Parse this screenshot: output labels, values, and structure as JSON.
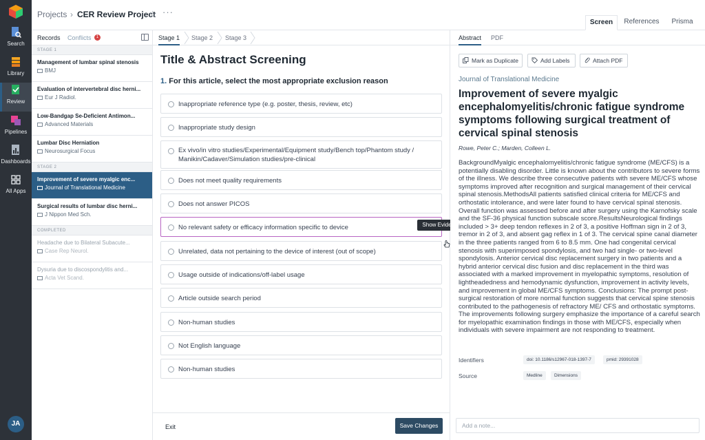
{
  "nav": {
    "items": [
      {
        "label": "Search",
        "icon": "search-doc-icon"
      },
      {
        "label": "Library",
        "icon": "library-icon"
      },
      {
        "label": "Review",
        "icon": "review-icon"
      },
      {
        "label": "Pipelines",
        "icon": "pipelines-icon"
      },
      {
        "label": "Dashboards",
        "icon": "dashboards-icon"
      },
      {
        "label": "All Apps",
        "icon": "grid-icon"
      }
    ],
    "avatar": "JA"
  },
  "header": {
    "breadcrumb": "Projects",
    "project": "CER Review Project",
    "tabs": [
      "Screen",
      "References",
      "Prisma"
    ],
    "active_tab": "Screen"
  },
  "records": {
    "tabs": {
      "records": "Records",
      "conflicts": "Conflicts",
      "conflict_count": "1"
    },
    "groups": [
      {
        "label": "STAGE 1",
        "items": [
          {
            "title": "Management of lumbar spinal stenosis",
            "source": "BMJ"
          },
          {
            "title": "Evaluation of intervertebral disc herni...",
            "source": "Eur J Radiol."
          },
          {
            "title": "Low-Bandgap Se-Deficient Antimon...",
            "source": "Advanced Materials"
          },
          {
            "title": "Lumbar Disc Herniation",
            "source": "Neurosurgical Focus"
          }
        ]
      },
      {
        "label": "STAGE 2",
        "items": [
          {
            "title": "Improvement of severe myalgic enc...",
            "source": "Journal of Translational Medicine"
          },
          {
            "title": "Surgical results of lumbar disc herni...",
            "source": "J Nippon Med Sch."
          }
        ]
      },
      {
        "label": "COMPLETED",
        "items": [
          {
            "title": "Headache due to Bilateral Subacute...",
            "source": "Case Rep Neurol."
          },
          {
            "title": "Dysuria due to discospondylitis and...",
            "source": "Acta Vet Scand."
          }
        ]
      }
    ]
  },
  "screening": {
    "stages": [
      "Stage 1",
      "Stage 2",
      "Stage 3"
    ],
    "title": "Title & Abstract Screening",
    "question_number": "1.",
    "question": "For this article, select the most appropriate exclusion reason",
    "options": [
      "Inappropriate reference type (e.g. poster, thesis, review, etc)",
      "Inappropriate study design",
      "Ex vivo/in vitro studies/Experimental/Equipment study/Bench top/Phantom study / Manikin/Cadaver/Simulation studies/pre-clinical",
      "Does not meet quality requirements",
      "Does not answer PICOS",
      "No relevant safety or efficacy information specific to device",
      "Unrelated, data not pertaining to the device of interest (out of scope)",
      "Usage outside of indications/off-label usage",
      "Article outside search period",
      "Non-human studies",
      "Not English language",
      "Non-human studies"
    ],
    "tooltip": "Show Evidence",
    "exit": "Exit",
    "save": "Save Changes"
  },
  "article": {
    "tabs": [
      "Abstract",
      "PDF"
    ],
    "actions": [
      "Mark as Duplicate",
      "Add Labels",
      "Attach PDF"
    ],
    "journal": "Journal of Translational Medicine",
    "title": "Improvement of severe myalgic encephalomyelitis/chronic fatigue syndrome symptoms following surgical treatment of cervical spinal stenosis",
    "authors": "Rowe, Peter C.; Marden, Colleen L.",
    "abstract": "BackgroundMyalgic encephalomyelitis/chronic fatigue syndrome (ME/CFS) is a potentially disabling disorder. Little is known about the contributors to severe forms of the illness. We describe three consecutive patients with severe ME/CFS whose symptoms improved after recognition and surgical management of their cervical spinal stenosis.MethodsAll patients satisfied clinical criteria for ME/CFS and orthostatic intolerance, and were later found to have cervical spinal stenosis. Overall function was assessed before and after surgery using the Karnofsky scale and the SF-36 physical function subscale score.ResultsNeurological findings included > 3+ deep tendon reflexes in 2 of 3, a positive Hoffman sign in 2 of 3, tremor in 2 of 3, and absent gag reflex in 1 of 3. The cervical spine canal diameter in the three patients ranged from 6 to 8.5 mm. One had congenital cervical stenosis with superimposed spondylosis, and two had single- or two-level spondylosis. Anterior cervical disc replacement surgery in two patients and a hybrid anterior cervical disc fusion and disc replacement in the third was associated with a marked improvement in myelopathic symptoms, resolution of lightheadedness and hemodynamic dysfunction, improvement in activity levels, and improvement in global ME/CFS symptoms. Conclusions: The prompt post-surgical restoration of more normal function suggests that cervical spine stenosis contributed to the pathogenesis of refractory ME/ CFS and orthostatic symptoms. The improvements following surgery emphasize the importance of a careful search for myelopathic examination findings in those with ME/CFS, especially when individuals with severe impairment are not responding to treatment.",
    "identifiers_label": "Identifiers",
    "identifiers": [
      "doi: 10.1186/s12967-018-1397-7",
      "pmid: 29391028"
    ],
    "source_label": "Source",
    "sources": [
      "Medline",
      "Dimensions"
    ],
    "note_placeholder": "Add a note..."
  }
}
